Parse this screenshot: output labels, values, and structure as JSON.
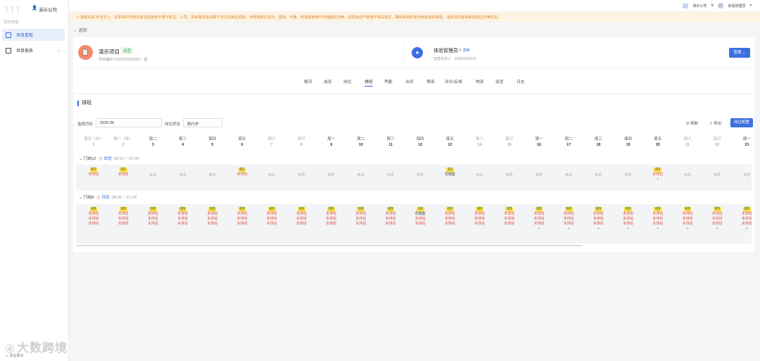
{
  "sidebar": {
    "company": "演示公司",
    "section": "职位管理",
    "menu": [
      {
        "label": "项目看板"
      },
      {
        "label": "项目报表"
      }
    ],
    "brand": "大数跨境",
    "collapse": "收起菜单"
  },
  "topbar": {
    "company": "演示公司",
    "user": "体验管理员"
  },
  "notice": "保密失效 安全至上：本系统中所有的信息包括但不限于职位、人员、项目等信息均属于本公司商业机密，未经授权的访问、复制、传播、修改或使用均可能触犯法律。请您务必严格遵守相关规定，确保系统的安全和信息的保密。违反规定者将承担相应法律责任。",
  "back": "返回",
  "project": {
    "name": "演示项目",
    "badge": "运营",
    "code": "项目编码 HJGX202503001",
    "code_suffix": "超",
    "icon": "📋"
  },
  "manager": {
    "name": "体验管理员",
    "change": "更换",
    "role": "运营负责人",
    "phone": "15566029514"
  },
  "manage_button": "管理",
  "tabs": [
    "概况",
    "成员",
    "岗位",
    "排班",
    "考勤",
    "合同",
    "费用",
    "评价/反馈",
    "物资",
    "巡查",
    "日志"
  ],
  "active_tab": "排班",
  "panel": {
    "title": "排班",
    "month_label": "选择月份",
    "month_value": "2025-06",
    "status_label": "岗位状态",
    "status_value": "执行中",
    "refresh": "刷新",
    "export": "导出",
    "config": "岗位配置"
  },
  "days": [
    {
      "w": "周日（休）",
      "d": "1",
      "rest": true
    },
    {
      "w": "周一（休）",
      "d": "2",
      "rest": true
    },
    {
      "w": "周二",
      "d": "3"
    },
    {
      "w": "周三",
      "d": "4"
    },
    {
      "w": "周四",
      "d": "5"
    },
    {
      "w": "周五",
      "d": "6"
    },
    {
      "w": "周六",
      "d": "7",
      "rest": true
    },
    {
      "w": "周日",
      "d": "8",
      "rest": true
    },
    {
      "w": "周一",
      "d": "9"
    },
    {
      "w": "周二",
      "d": "10"
    },
    {
      "w": "周三",
      "d": "11"
    },
    {
      "w": "周四",
      "d": "12"
    },
    {
      "w": "周五",
      "d": "13"
    },
    {
      "w": "周六",
      "d": "14",
      "rest": true
    },
    {
      "w": "周日",
      "d": "15",
      "rest": true
    },
    {
      "w": "周一",
      "d": "16"
    },
    {
      "w": "周二",
      "d": "17"
    },
    {
      "w": "周三",
      "d": "18"
    },
    {
      "w": "周四",
      "d": "19"
    },
    {
      "w": "周五",
      "d": "20"
    },
    {
      "w": "周六",
      "d": "21",
      "rest": true
    },
    {
      "w": "周日",
      "d": "22",
      "rest": true
    },
    {
      "w": "周一",
      "d": "23"
    }
  ],
  "groups": [
    {
      "name": "门岗12",
      "shift": "白班",
      "time": "08:51 ~ 22:00",
      "cells": [
        {
          "type": "count",
          "count": "0/1",
          "lines": [
            "未排班"
          ]
        },
        {
          "type": "count",
          "count": "0/1",
          "lines": [
            "未排班"
          ]
        },
        {
          "type": "rest",
          "label": "休息"
        },
        {
          "type": "rest",
          "label": "休息"
        },
        {
          "type": "rest",
          "label": "休息"
        },
        {
          "type": "count",
          "count": "0/1",
          "lines": [
            "未排班"
          ]
        },
        {
          "type": "rest",
          "label": "休息"
        },
        {
          "type": "rest",
          "label": "休息"
        },
        {
          "type": "rest",
          "label": "休息"
        },
        {
          "type": "rest",
          "label": "休息"
        },
        {
          "type": "rest",
          "label": "休息"
        },
        {
          "type": "rest",
          "label": "休息"
        },
        {
          "type": "assigned",
          "count": "1/1",
          "lines": [
            "花瑞奎"
          ]
        },
        {
          "type": "rest",
          "label": "休息"
        },
        {
          "type": "rest",
          "label": "休息"
        },
        {
          "type": "rest",
          "label": "休息"
        },
        {
          "type": "rest",
          "label": "休息"
        },
        {
          "type": "rest",
          "label": "休息"
        },
        {
          "type": "rest",
          "label": "休息"
        },
        {
          "type": "count",
          "count": "0/1",
          "lines": [
            "未排班"
          ],
          "plus": "+"
        },
        {
          "type": "rest",
          "label": "休息"
        },
        {
          "type": "rest",
          "label": "休息"
        },
        {
          "type": "rest",
          "label": "休息"
        }
      ]
    },
    {
      "name": "门岗8",
      "shift": "日班",
      "time": "08:00 ~ 21:00",
      "cells": [
        {
          "count": "0/3",
          "lines": [
            "未排班",
            "未排班",
            "未排班"
          ]
        },
        {
          "count": "0/3",
          "lines": [
            "未排班",
            "未排班",
            "未排班"
          ]
        },
        {
          "count": "0/3",
          "lines": [
            "未排班",
            "未排班",
            "未排班"
          ]
        },
        {
          "count": "0/3",
          "lines": [
            "未排班",
            "未排班",
            "未排班"
          ]
        },
        {
          "count": "0/3",
          "lines": [
            "未排班",
            "未排班",
            "未排班"
          ]
        },
        {
          "count": "0/3",
          "lines": [
            "未排班",
            "未排班",
            "未排班"
          ]
        },
        {
          "count": "0/3",
          "lines": [
            "未排班",
            "未排班",
            "未排班"
          ]
        },
        {
          "count": "0/3",
          "lines": [
            "未排班",
            "未排班",
            "未排班"
          ]
        },
        {
          "count": "0/3",
          "lines": [
            "未排班",
            "未排班",
            "未排班"
          ]
        },
        {
          "count": "0/3",
          "lines": [
            "未排班",
            "未排班",
            "未排班"
          ]
        },
        {
          "count": "0/3",
          "lines": [
            "未排班",
            "未排班",
            "未排班"
          ]
        },
        {
          "count": "1/3",
          "lines": [
            "花瑞奎",
            "未排班",
            "未排班"
          ]
        },
        {
          "count": "0/3",
          "lines": [
            "未排班",
            "未排班",
            "未排班"
          ]
        },
        {
          "count": "0/3",
          "lines": [
            "未排班",
            "未排班",
            "未排班"
          ]
        },
        {
          "count": "0/3",
          "lines": [
            "未排班",
            "未排班",
            "未排班"
          ]
        },
        {
          "count": "0/3",
          "lines": [
            "未排班",
            "未排班",
            "未排班"
          ],
          "plus": "+"
        },
        {
          "count": "0/3",
          "lines": [
            "未排班",
            "未排班",
            "未排班"
          ],
          "plus": "+"
        },
        {
          "count": "0/3",
          "lines": [
            "未排班",
            "未排班",
            "未排班"
          ],
          "plus": "+"
        },
        {
          "count": "0/3",
          "lines": [
            "未排班",
            "未排班",
            "未排班"
          ],
          "plus": "+"
        },
        {
          "count": "0/3",
          "lines": [
            "未排班",
            "未排班",
            "未排班"
          ],
          "plus": "+"
        },
        {
          "count": "0/3",
          "lines": [
            "未排班",
            "未排班",
            "未排班"
          ],
          "plus": "+"
        },
        {
          "count": "0/3",
          "lines": [
            "未排班",
            "未排班",
            "未排班"
          ],
          "plus": "+"
        },
        {
          "count": "0/3",
          "lines": [
            "未排班",
            "未排班",
            "未排班"
          ],
          "plus": "+"
        }
      ]
    }
  ]
}
